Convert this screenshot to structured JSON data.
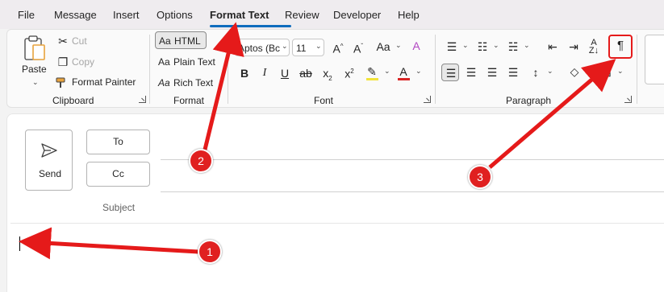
{
  "menu": {
    "tabs": [
      {
        "label": "File"
      },
      {
        "label": "Message"
      },
      {
        "label": "Insert"
      },
      {
        "label": "Options"
      },
      {
        "label": "Format Text"
      },
      {
        "label": "Review"
      },
      {
        "label": "Developer"
      },
      {
        "label": "Help"
      }
    ],
    "active_tab": "Format Text"
  },
  "ribbon": {
    "clipboard": {
      "paste_label": "Paste",
      "cut_label": "Cut",
      "copy_label": "Copy",
      "format_painter_label": "Format Painter",
      "group_label": "Clipboard"
    },
    "format": {
      "html_label": "HTML",
      "plain_text_label": "Plain Text",
      "rich_text_label": "Rich Text",
      "group_label": "Format",
      "selected": "HTML"
    },
    "font": {
      "font_name": "Aptos (Bc",
      "font_size": "11",
      "group_label": "Font"
    },
    "paragraph": {
      "group_label": "Paragraph"
    }
  },
  "compose": {
    "send_label": "Send",
    "to_label": "To",
    "cc_label": "Cc",
    "subject_label": "Subject"
  },
  "annotations": {
    "badge1": "1",
    "badge2": "2",
    "badge3": "3",
    "arrow_color": "#e51a1a"
  }
}
